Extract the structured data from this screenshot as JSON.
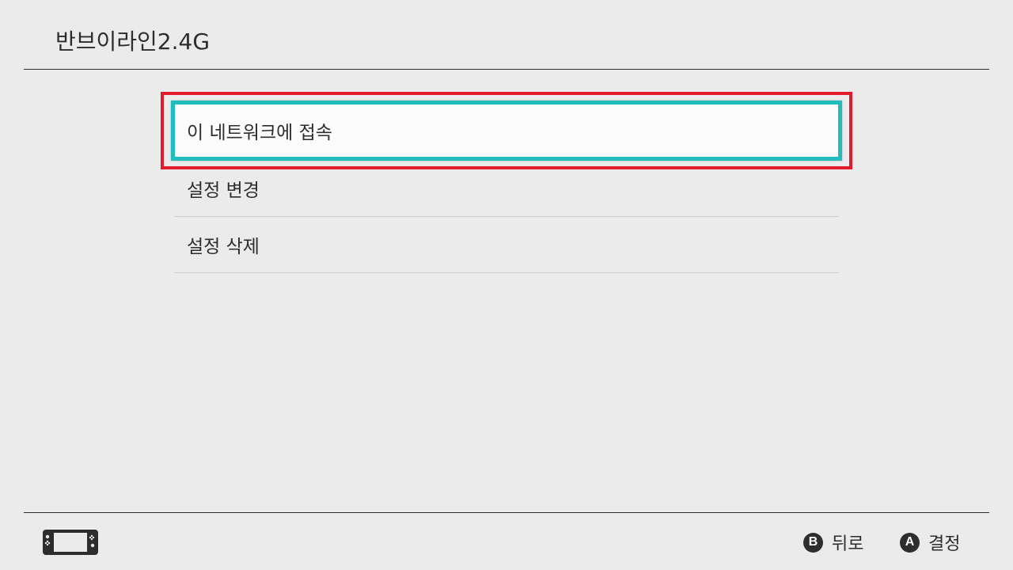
{
  "header": {
    "title": "반브이라인2.4G"
  },
  "menu": {
    "items": [
      {
        "label": "이 네트워크에 접속",
        "selected": true
      },
      {
        "label": "설정 변경",
        "selected": false
      },
      {
        "label": "설정 삭제",
        "selected": false
      }
    ]
  },
  "footer": {
    "console_icon": "handheld-console-icon",
    "back_button": {
      "glyph": "B",
      "label": "뒤로"
    },
    "ok_button": {
      "glyph": "A",
      "label": "결정"
    }
  },
  "colors": {
    "background": "#ebebeb",
    "selection_border": "#21bdbd",
    "highlight_frame": "#e21b2b",
    "text": "#2d2d2d"
  }
}
